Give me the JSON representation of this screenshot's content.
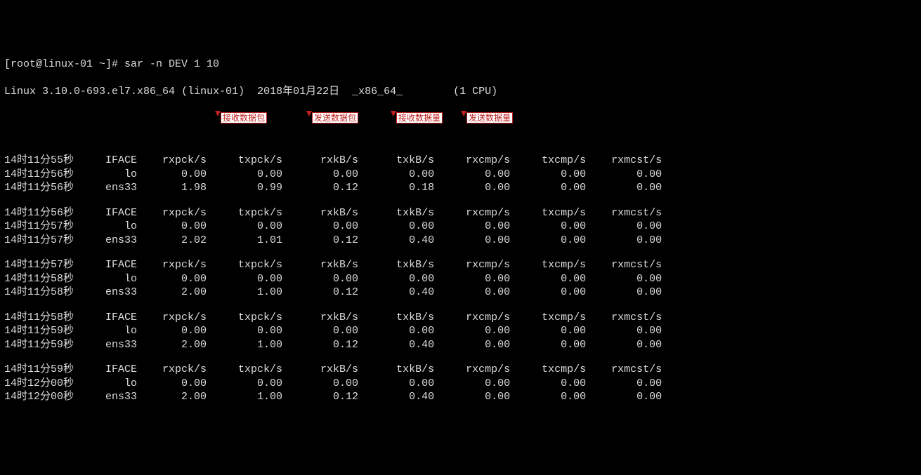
{
  "prompt": "[root@linux-01 ~]# ",
  "command": "sar -n DEV 1 10",
  "sysline": {
    "kernel": "Linux 3.10.0-693.el7.x86_64",
    "host": "(linux-01)",
    "date": "2018年01月22日",
    "arch": "_x86_64_",
    "cpu": "(1 CPU)"
  },
  "annotations": {
    "rxpck": "接收数据包",
    "txpck": "发送数据包",
    "rxkb": "接收数据量",
    "txkb": "发送数据量"
  },
  "columns": [
    "IFACE",
    "rxpck/s",
    "txpck/s",
    "rxkB/s",
    "txkB/s",
    "rxcmp/s",
    "txcmp/s",
    "rxmcst/s"
  ],
  "blocks": [
    {
      "header_time": "14时11分55秒",
      "rows": [
        {
          "time": "14时11分56秒",
          "iface": "lo",
          "vals": [
            "0.00",
            "0.00",
            "0.00",
            "0.00",
            "0.00",
            "0.00",
            "0.00"
          ]
        },
        {
          "time": "14时11分56秒",
          "iface": "ens33",
          "vals": [
            "1.98",
            "0.99",
            "0.12",
            "0.18",
            "0.00",
            "0.00",
            "0.00"
          ]
        }
      ]
    },
    {
      "header_time": "14时11分56秒",
      "rows": [
        {
          "time": "14时11分57秒",
          "iface": "lo",
          "vals": [
            "0.00",
            "0.00",
            "0.00",
            "0.00",
            "0.00",
            "0.00",
            "0.00"
          ]
        },
        {
          "time": "14时11分57秒",
          "iface": "ens33",
          "vals": [
            "2.02",
            "1.01",
            "0.12",
            "0.40",
            "0.00",
            "0.00",
            "0.00"
          ]
        }
      ]
    },
    {
      "header_time": "14时11分57秒",
      "rows": [
        {
          "time": "14时11分58秒",
          "iface": "lo",
          "vals": [
            "0.00",
            "0.00",
            "0.00",
            "0.00",
            "0.00",
            "0.00",
            "0.00"
          ]
        },
        {
          "time": "14时11分58秒",
          "iface": "ens33",
          "vals": [
            "2.00",
            "1.00",
            "0.12",
            "0.40",
            "0.00",
            "0.00",
            "0.00"
          ]
        }
      ]
    },
    {
      "header_time": "14时11分58秒",
      "rows": [
        {
          "time": "14时11分59秒",
          "iface": "lo",
          "vals": [
            "0.00",
            "0.00",
            "0.00",
            "0.00",
            "0.00",
            "0.00",
            "0.00"
          ]
        },
        {
          "time": "14时11分59秒",
          "iface": "ens33",
          "vals": [
            "2.00",
            "1.00",
            "0.12",
            "0.40",
            "0.00",
            "0.00",
            "0.00"
          ]
        }
      ]
    },
    {
      "header_time": "14时11分59秒",
      "rows": [
        {
          "time": "14时12分00秒",
          "iface": "lo",
          "vals": [
            "0.00",
            "0.00",
            "0.00",
            "0.00",
            "0.00",
            "0.00",
            "0.00"
          ]
        },
        {
          "time": "14时12分00秒",
          "iface": "ens33",
          "vals": [
            "2.00",
            "1.00",
            "0.12",
            "0.40",
            "0.00",
            "0.00",
            "0.00"
          ]
        }
      ]
    }
  ]
}
